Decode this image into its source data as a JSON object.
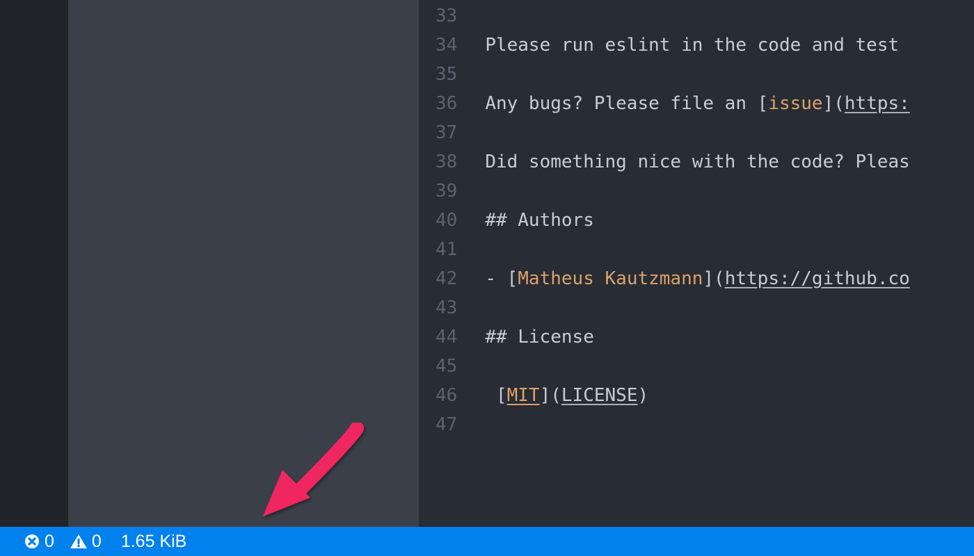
{
  "editor": {
    "lines": [
      {
        "num": "33",
        "segments": []
      },
      {
        "num": "34",
        "segments": [
          {
            "t": "Please run eslint in the code and test ",
            "c": "dim"
          }
        ]
      },
      {
        "num": "35",
        "segments": []
      },
      {
        "num": "36",
        "segments": [
          {
            "t": "Any bugs? Please file an ",
            "c": "dim"
          },
          {
            "t": "[",
            "c": "dim"
          },
          {
            "t": "issue",
            "c": "orange"
          },
          {
            "t": "]",
            "c": "dim"
          },
          {
            "t": "(",
            "c": "dim"
          },
          {
            "t": "https:",
            "c": "dim underline"
          }
        ]
      },
      {
        "num": "37",
        "segments": []
      },
      {
        "num": "38",
        "segments": [
          {
            "t": "Did something nice with the code? Pleas",
            "c": "dim"
          }
        ]
      },
      {
        "num": "39",
        "segments": []
      },
      {
        "num": "40",
        "segments": [
          {
            "t": "## Authors",
            "c": "dim"
          }
        ]
      },
      {
        "num": "41",
        "segments": []
      },
      {
        "num": "42",
        "segments": [
          {
            "t": "- ",
            "c": "dim"
          },
          {
            "t": "[",
            "c": "dim"
          },
          {
            "t": "Matheus Kautzmann",
            "c": "orange"
          },
          {
            "t": "]",
            "c": "dim"
          },
          {
            "t": "(",
            "c": "dim"
          },
          {
            "t": "https://github.co",
            "c": "dim underline"
          }
        ]
      },
      {
        "num": "43",
        "segments": []
      },
      {
        "num": "44",
        "segments": [
          {
            "t": "## License",
            "c": "dim"
          }
        ]
      },
      {
        "num": "45",
        "segments": []
      },
      {
        "num": "46",
        "segments": [
          {
            "t": " ",
            "c": "dim"
          },
          {
            "t": "[",
            "c": "dim"
          },
          {
            "t": "MIT",
            "c": "orange underline-orange"
          },
          {
            "t": "]",
            "c": "dim"
          },
          {
            "t": "(",
            "c": "dim"
          },
          {
            "t": "LICENSE",
            "c": "dim underline"
          },
          {
            "t": ")",
            "c": "dim"
          }
        ]
      },
      {
        "num": "47",
        "segments": []
      }
    ]
  },
  "status": {
    "errors": "0",
    "warnings": "0",
    "filesize": "1.65 KiB"
  }
}
